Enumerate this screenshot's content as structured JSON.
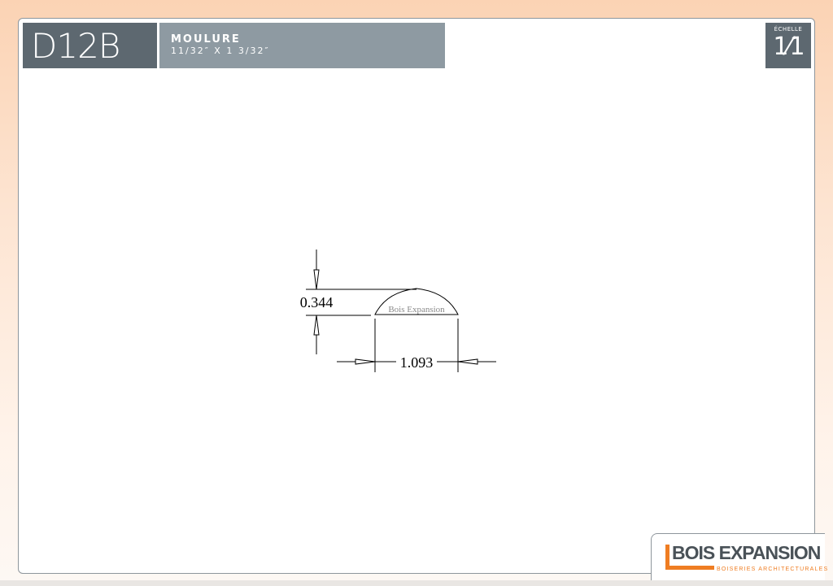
{
  "header": {
    "code": "D12B",
    "type": "MOULURE",
    "dimensions": "11/32″ X 1 3/32″",
    "scale_label": "ÉCHELLE",
    "scale_value": "1⁄1"
  },
  "drawing": {
    "height_label": "0.344",
    "width_label": "1.093",
    "watermark": "Bois Expansion",
    "profile_width_in": 1.093,
    "profile_height_in": 0.344
  },
  "brand": {
    "name": "BOIS EXPANSION",
    "tagline": "BOISERIES ARCHITECTURALES",
    "accent_color": "#ef7d22",
    "panel_color": "#5d6870"
  }
}
